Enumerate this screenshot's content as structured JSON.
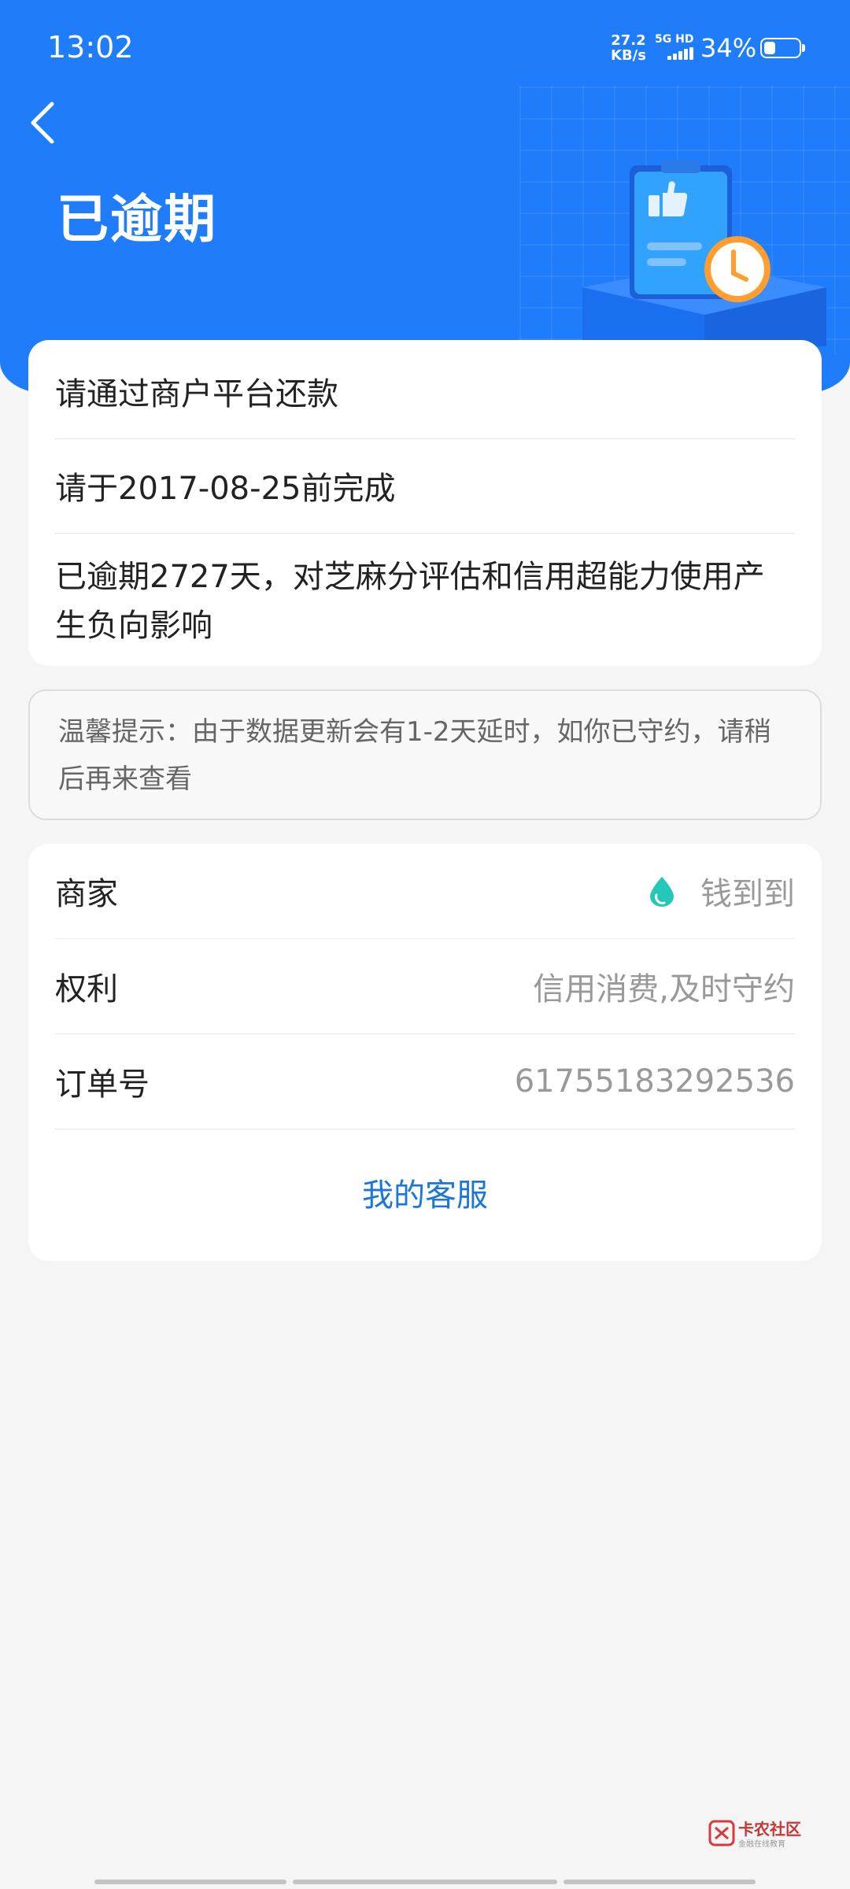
{
  "status_bar": {
    "time": "13:02",
    "net_speed_value": "27.2",
    "net_speed_unit": "KB/s",
    "network_type": "5G HD",
    "battery_percent": "34%",
    "battery_level": 0.34
  },
  "header": {
    "title": "已逾期",
    "back_icon": "chevron-left-icon",
    "background_color": "#1f7dfb"
  },
  "status_card": {
    "line1": "请通过商户平台还款",
    "line2": "请于2017-08-25前完成",
    "line3": "已逾期2727天，对芝麻分评估和信用超能力使用产生负向影响"
  },
  "tip": {
    "text": "温馨提示：由于数据更新会有1-2天延时，如你已守约，请稍后再来查看"
  },
  "info_card": {
    "rows": [
      {
        "label": "商家",
        "value": "钱到到"
      },
      {
        "label": "权利",
        "value": "信用消费,及时守约"
      },
      {
        "label": "订单号",
        "value": "61755183292536"
      }
    ],
    "merchant_icon": "water-drop-icon",
    "service_link": "我的客服",
    "link_color": "#1a76d8"
  },
  "watermark": {
    "text": "卡农社区",
    "subtext": "金融在线教育"
  }
}
